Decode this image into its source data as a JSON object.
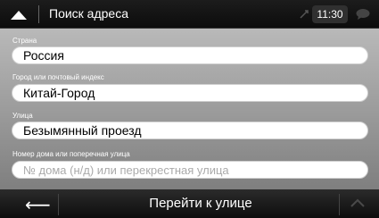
{
  "header": {
    "title": "Поиск адреса",
    "time": "11:30"
  },
  "fields": {
    "country": {
      "label": "Страна",
      "value": "Россия"
    },
    "city": {
      "label": "Город или почтовый индекс",
      "value": "Китай-Город"
    },
    "street": {
      "label": "Улица",
      "value": "Безымянный проезд"
    },
    "house": {
      "label": "Номер дома или поперечная улица",
      "placeholder": "№ дома (н/д) или перекрестная улица"
    }
  },
  "footer": {
    "go_label": "Перейти к улице"
  }
}
